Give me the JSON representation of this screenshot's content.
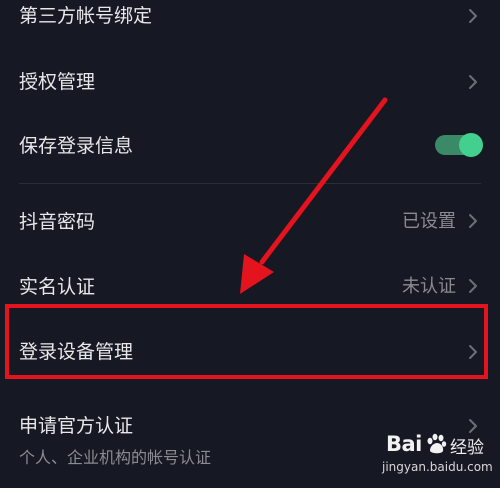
{
  "settings": {
    "rows": [
      {
        "label": "第三方帐号绑定"
      },
      {
        "label": "授权管理"
      },
      {
        "label": "保存登录信息",
        "toggle_on": true
      },
      {
        "label": "抖音密码",
        "value": "已设置"
      },
      {
        "label": "实名认证",
        "value": "未认证"
      },
      {
        "label": "登录设备管理"
      },
      {
        "label": "申请官方认证",
        "sublabel": "个人、企业机构的帐号认证"
      }
    ]
  },
  "watermark": {
    "brand": "Bai",
    "brand_suffix": "经验",
    "url": "jingyan.baidu.com"
  },
  "colors": {
    "background": "#161823",
    "toggle_on": "#43d08f",
    "highlight": "#e3141d"
  }
}
